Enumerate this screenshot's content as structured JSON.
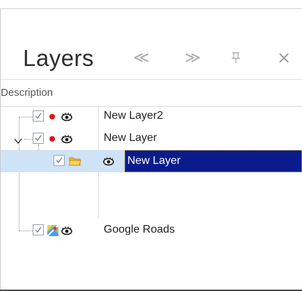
{
  "panel": {
    "title": "Layers",
    "buttons": {
      "prev": "≪",
      "next": "≫",
      "pin": "⊥",
      "close": "×"
    }
  },
  "columns": {
    "description": "Description"
  },
  "layers": [
    {
      "label": "New Layer2",
      "checked": true,
      "icon": "red-dot-icon",
      "visible": true
    },
    {
      "label": "New Layer",
      "checked": true,
      "icon": "red-dot-icon",
      "visible": true,
      "expanded": true
    },
    {
      "label": "New Layer",
      "checked": true,
      "icon": "folder-icon",
      "visible": true,
      "selected": true
    },
    {
      "label": "Google Roads",
      "checked": true,
      "icon": "google-map-icon",
      "visible": true
    }
  ],
  "colors": {
    "selection": "#0a1c8c",
    "selection_row": "#cfe3f7",
    "red_dot": "#e0101a"
  }
}
